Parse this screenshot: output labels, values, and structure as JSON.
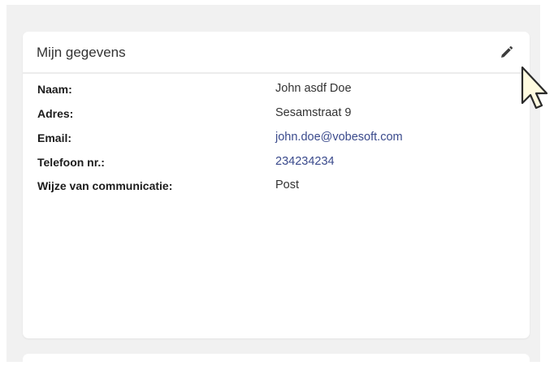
{
  "card": {
    "title": "Mijn gegevens"
  },
  "details": [
    {
      "label": "Naam:",
      "value": "John asdf Doe"
    },
    {
      "label": "Adres:",
      "value": "Sesamstraat 9"
    },
    {
      "label": "Email:",
      "value": "john.doe@vobesoft.com"
    },
    {
      "label": "Telefoon nr.:",
      "value": "234234234"
    },
    {
      "label": "Wijze van communicatie:",
      "value": "Post"
    }
  ],
  "icons": {
    "edit": "pencil-icon",
    "cursor": "mouse-pointer-icon"
  },
  "colors": {
    "background": "#f1f1f1",
    "card": "#ffffff",
    "link": "#3a4a8c",
    "label": "#1c1c1c",
    "cursor_fill": "#fffbe0"
  }
}
